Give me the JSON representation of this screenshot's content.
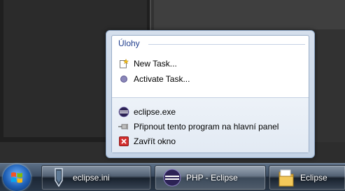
{
  "jump_list": {
    "category_title": "Úlohy",
    "tasks": [
      {
        "label": "New Task...",
        "icon": "new-task-icon"
      },
      {
        "label": "Activate Task...",
        "icon": "activate-task-icon"
      }
    ],
    "app_items": [
      {
        "label": "eclipse.exe",
        "icon": "eclipse-icon"
      },
      {
        "label": "Připnout tento program na hlavní panel",
        "icon": "pin-icon"
      },
      {
        "label": "Zavřít okno",
        "icon": "close-window-icon"
      }
    ]
  },
  "taskbar": {
    "start_icon": "windows-logo-icon",
    "buttons": [
      {
        "label": "eclipse.ini",
        "icon": "pen-document-icon",
        "active": false
      },
      {
        "label": "PHP - Eclipse",
        "icon": "eclipse-icon",
        "active": true
      },
      {
        "label": "Eclipse",
        "icon": "folder-icon",
        "active": false
      }
    ]
  },
  "colors": {
    "category_title": "#1e3c8c",
    "eclipse_purple": "#2c2255",
    "close_red": "#d32f2f"
  }
}
